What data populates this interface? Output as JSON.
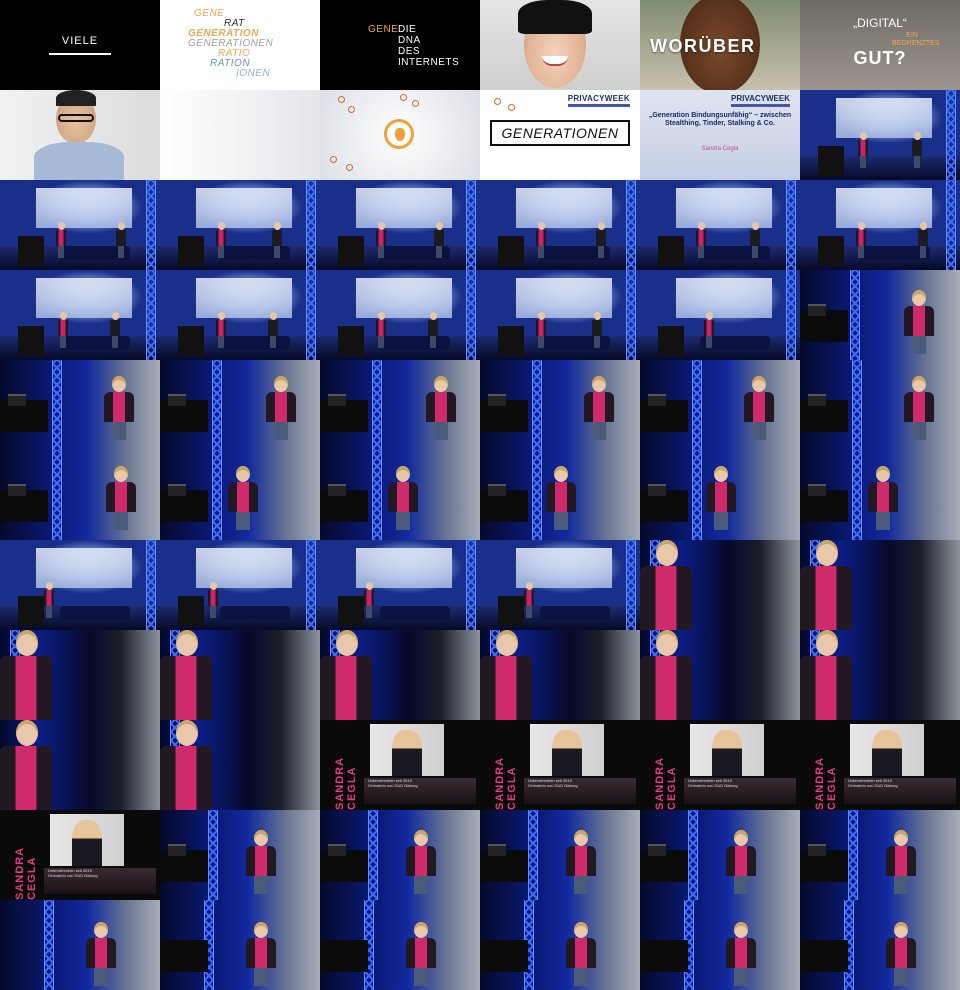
{
  "slides": {
    "viele": "VIELE",
    "words": [
      "GENE",
      "RAT",
      "GENERATION",
      "GENERATIONEN",
      "RATIO",
      "RATION",
      "IONEN"
    ],
    "dna": {
      "accent": "GENE",
      "lines": [
        "DIE",
        "DNA",
        "DES",
        "INTERNETS"
      ]
    },
    "worueber": "WORÜBER",
    "digital": {
      "top": "„DIGITAL“",
      "mid": "EIN BEGRENZTES",
      "big": "GUT?"
    },
    "brand": "PRIVACYWEEK",
    "generationen": "GENERATIONEN",
    "talk_title": "„Generation Bindungsunfähig“ – zwischen Stealthing, Tinder, Stalking & Co.",
    "talk_speaker": "Sandra Cegla",
    "speaker_name": "SANDRA CEGLA",
    "speaker_caption": [
      "Unternehmerin seit 2019",
      "Gründerin von DUD Bildung"
    ]
  },
  "colors": {
    "accent_pink": "#d0206a",
    "stage_blue": "#132a9e",
    "slide_orange": "#f2a03a"
  }
}
